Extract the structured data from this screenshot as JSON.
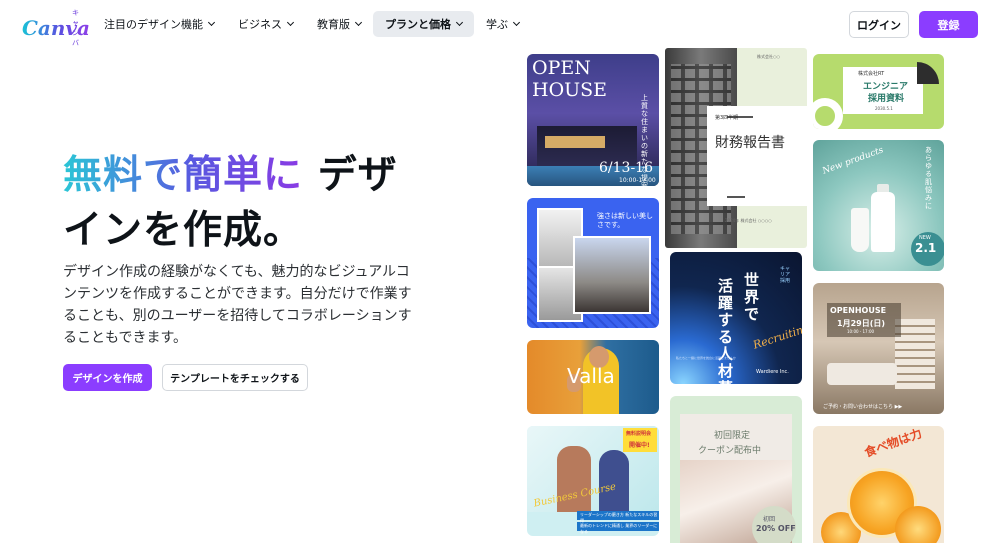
{
  "nav": {
    "logo_kana": "キャンバ",
    "logo_text": "Canva",
    "menu": [
      {
        "label": "注目のデザイン機能"
      },
      {
        "label": "ビジネス"
      },
      {
        "label": "教育版"
      },
      {
        "label": "プランと価格"
      },
      {
        "label": "学ぶ"
      }
    ],
    "login": "ログイン",
    "signup": "登録"
  },
  "hero": {
    "title_highlight": "無料で簡単に",
    "title_rest": " デザインを作成。",
    "description": "デザイン作成の経験がなくても、魅力的なビジュアルコンテンツを作成することができます。自分だけで作業することも、別のユーザーを招待してコラボレーションすることもできます。",
    "cta_primary": "デザインを作成",
    "cta_secondary": "テンプレートをチェックする"
  },
  "cards": {
    "openhouse": {
      "title": "OPEN HOUSE",
      "vertical": "上質な住まいの新たな提案",
      "date": "6/13-16",
      "time": "10:00-17:00"
    },
    "finance": {
      "title": "財務報告書",
      "subtitle": "第3四半期",
      "top": "株式会社○○",
      "bottom": "2024年 株式会社 ○○○○"
    },
    "engineer": {
      "company": "株式会社RT",
      "line1": "エンジニア",
      "line2": "採用資料",
      "date": "2030.5.1"
    },
    "cosmetics": {
      "script": "New products",
      "vertical": "あらゆる肌悩みに",
      "new": "NEW",
      "date": "2.1"
    },
    "fitness": {
      "text": "強さは新しい美しさです。"
    },
    "recruiting": {
      "line1": "世界で",
      "line2": "活躍する人材募集！",
      "side": "キャリア採用",
      "script": "Recruiting",
      "small": "私たちと一緒に世界を舞台に活躍しませんか",
      "company": "Wardiere Inc."
    },
    "valla": {
      "name": "Valla"
    },
    "coupon": {
      "line1": "初回限定",
      "line2": "クーポン配布中",
      "badge1": "初回",
      "badge2": "20% OFF"
    },
    "interior": {
      "line1": "OPENHOUSE",
      "line2": "1月29日(日)",
      "line3": "10:00 - 17:00",
      "footer": "ご予約・お問い合わせはこちら ▶▶"
    },
    "business": {
      "badge1": "無料説明会",
      "badge2": "開催中!",
      "script": "Business Course",
      "strip1": "リーダーシップの磨き方 新たなスキルの習得",
      "strip2": "最新のトレンドに精通し 業界のリーダーになる"
    },
    "food": {
      "title": "食べ物は力"
    }
  }
}
